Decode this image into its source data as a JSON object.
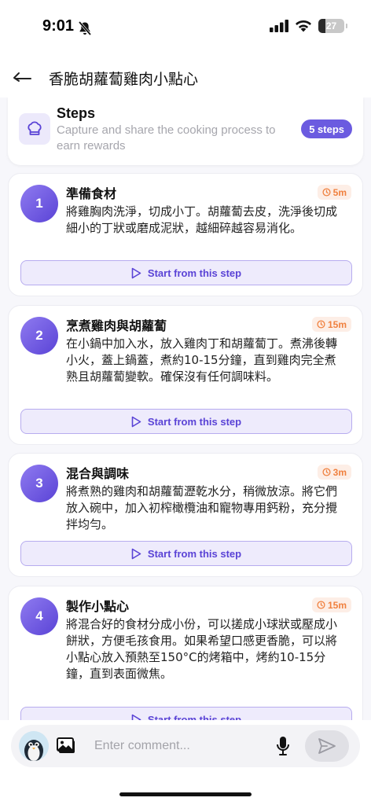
{
  "status_bar": {
    "time": "9:01",
    "battery": "27",
    "battery_level": 0.27
  },
  "header": {
    "title": "香脆胡蘿蔔雞肉小點心"
  },
  "steps_card": {
    "title": "Steps",
    "subtitle": "Capture and share the cooking process to earn rewards",
    "badge": "5 steps"
  },
  "steps": [
    {
      "number": "1",
      "title": "準備食材",
      "time": "5m",
      "description": "將雞胸肉洗淨，切成小丁。胡蘿蔔去皮，洗淨後切成細小的丁狀或磨成泥狀，越細碎越容易消化。",
      "button": "Start from this step"
    },
    {
      "number": "2",
      "title": "烹煮雞肉與胡蘿蔔",
      "time": "15m",
      "description": "在小鍋中加入水，放入雞肉丁和胡蘿蔔丁。煮沸後轉小火，蓋上鍋蓋，煮約10-15分鐘，直到雞肉完全煮熟且胡蘿蔔變軟。確保沒有任何調味料。",
      "button": "Start from this step"
    },
    {
      "number": "3",
      "title": "混合與調味",
      "time": "3m",
      "description": "將煮熟的雞肉和胡蘿蔔瀝乾水分，稍微放涼。將它們放入碗中，加入初榨橄欖油和寵物專用鈣粉，充分攪拌均勻。",
      "button": "Start from this step"
    },
    {
      "number": "4",
      "title": "製作小點心",
      "time": "15m",
      "description": "將混合好的食材分成小份，可以搓成小球狀或壓成小餅狀，方便毛孩食用。如果希望口感更香脆，可以將小點心放入預熱至150°C的烤箱中，烤約10-15分鐘，直到表面微焦。",
      "button": "Start from this step"
    }
  ],
  "comment_bar": {
    "placeholder": "Enter comment..."
  },
  "colors": {
    "accent": "#5a43d6",
    "time_accent": "#f0813f"
  }
}
